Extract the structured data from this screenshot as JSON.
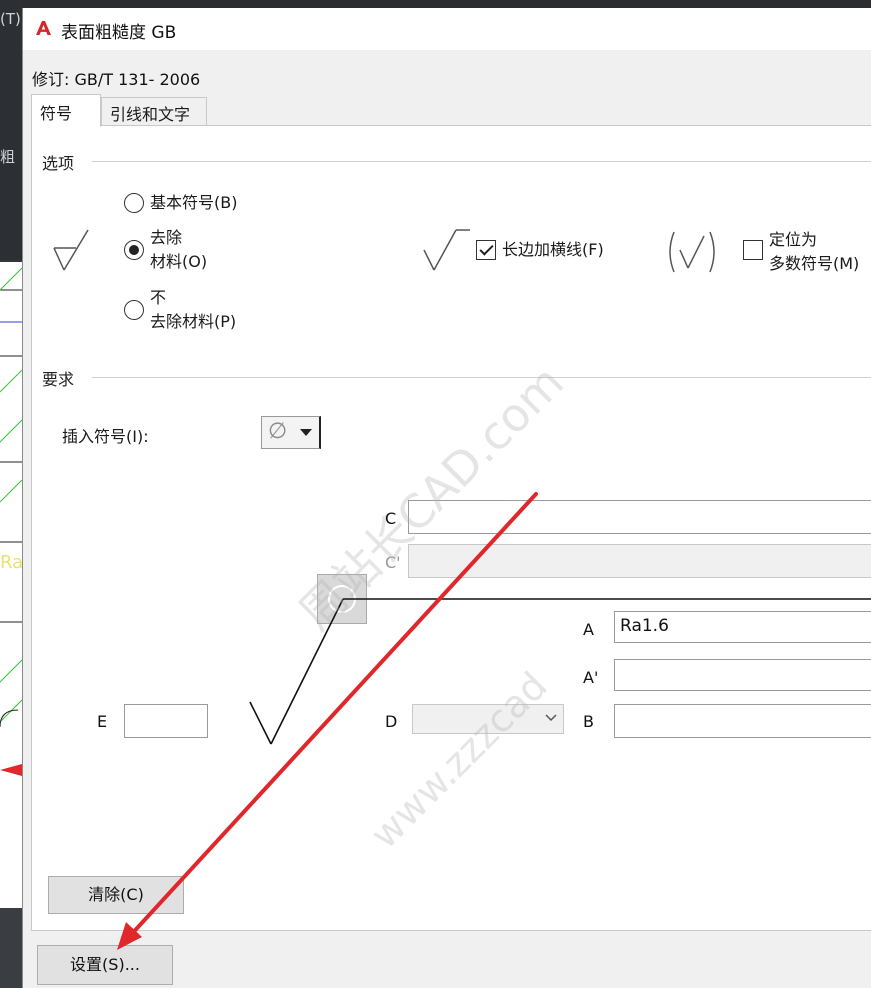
{
  "background": {
    "fragments": [
      "(T)",
      "粗",
      "Ra"
    ]
  },
  "dialog": {
    "title": "表面粗糙度 GB",
    "revision": "修订: GB/T 131- 2006",
    "tabs": [
      {
        "label": "符号",
        "active": true
      },
      {
        "label": "引线和文字",
        "active": false
      }
    ]
  },
  "options": {
    "group_title": "选项",
    "radios": [
      {
        "label": "基本符号(B)",
        "checked": false
      },
      {
        "label_line1": "去除",
        "label_line2": "材料(O)",
        "checked": true
      },
      {
        "label_line1": "不",
        "label_line2": "去除材料(P)",
        "checked": false
      }
    ],
    "long_side_bar": {
      "label": "长边加横线(F)",
      "checked": true
    },
    "position_majority": {
      "label_line1": "定位为",
      "label_line2": "多数符号(M)",
      "checked": false
    }
  },
  "requirements": {
    "group_title": "要求",
    "insert_symbol_label": "插入符号(I):",
    "insert_symbol_value": "∅",
    "fields": {
      "C": {
        "letter": "C",
        "value": ""
      },
      "C_prime": {
        "letter": "C'",
        "value": "",
        "disabled": true
      },
      "A": {
        "letter": "A",
        "value": "Ra1.6"
      },
      "A_prime": {
        "letter": "A'",
        "value": ""
      },
      "B": {
        "letter": "B",
        "value": ""
      },
      "D": {
        "letter": "D",
        "value": ""
      },
      "E": {
        "letter": "E",
        "value": ""
      }
    }
  },
  "buttons": {
    "clear": "清除(C)",
    "settings": "设置(S)..."
  },
  "watermark": {
    "line1": "周站长CAD",
    "line2": ".com",
    "line3": "www.zzzcad"
  },
  "colors": {
    "annotation_arrow": "#e0272c",
    "dialog_bg": "#f0f0f0"
  }
}
